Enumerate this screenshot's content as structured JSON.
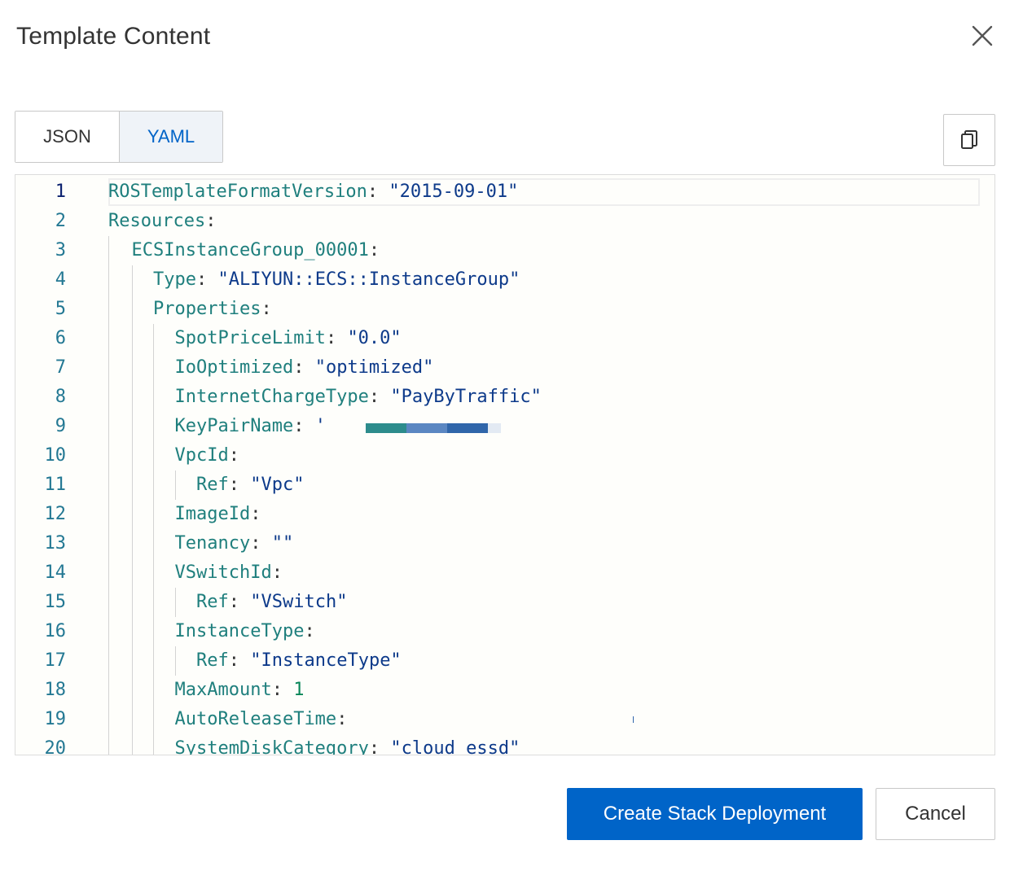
{
  "dialog": {
    "title": "Template Content"
  },
  "tabs": [
    {
      "label": "JSON",
      "active": false
    },
    {
      "label": "YAML",
      "active": true
    }
  ],
  "icons": {
    "close": "close-icon",
    "copy": "copy-icon"
  },
  "editor": {
    "line_numbers": [
      "1",
      "2",
      "3",
      "4",
      "5",
      "6",
      "7",
      "8",
      "9",
      "10",
      "11",
      "12",
      "13",
      "14",
      "15",
      "16",
      "17",
      "18",
      "19",
      "20"
    ],
    "lines": [
      {
        "key": "ROSTemplateFormatVersion",
        "sep": ": ",
        "val": "\"2015-09-01\"",
        "type": "s"
      },
      {
        "key": "Resources",
        "sep": ":",
        "val": "",
        "type": "s"
      },
      {
        "key": "ECSInstanceGroup_00001",
        "sep": ":",
        "val": "",
        "type": "s"
      },
      {
        "key": "Type",
        "sep": ": ",
        "val": "\"ALIYUN::ECS::InstanceGroup\"",
        "type": "s"
      },
      {
        "key": "Properties",
        "sep": ":",
        "val": "",
        "type": "s"
      },
      {
        "key": "SpotPriceLimit",
        "sep": ": ",
        "val": "\"0.0\"",
        "type": "s"
      },
      {
        "key": "IoOptimized",
        "sep": ": ",
        "val": "\"optimized\"",
        "type": "s"
      },
      {
        "key": "InternetChargeType",
        "sep": ": ",
        "val": "\"PayByTraffic\"",
        "type": "s"
      },
      {
        "key": "KeyPairName",
        "sep": ": ",
        "val": "'",
        "type": "s"
      },
      {
        "key": "VpcId",
        "sep": ":",
        "val": "",
        "type": "s"
      },
      {
        "key": "Ref",
        "sep": ": ",
        "val": "\"Vpc\"",
        "type": "s"
      },
      {
        "key": "ImageId",
        "sep": ":",
        "val": "",
        "type": "s"
      },
      {
        "key": "Tenancy",
        "sep": ": ",
        "val": "\"\"",
        "type": "s"
      },
      {
        "key": "VSwitchId",
        "sep": ":",
        "val": "",
        "type": "s"
      },
      {
        "key": "Ref",
        "sep": ": ",
        "val": "\"VSwitch\"",
        "type": "s"
      },
      {
        "key": "InstanceType",
        "sep": ":",
        "val": "",
        "type": "s"
      },
      {
        "key": "Ref",
        "sep": ": ",
        "val": "\"InstanceType\"",
        "type": "s"
      },
      {
        "key": "MaxAmount",
        "sep": ": ",
        "val": "1",
        "type": "n"
      },
      {
        "key": "AutoReleaseTime",
        "sep": ":",
        "val": "",
        "type": "s"
      },
      {
        "key": "SystemDiskCategory",
        "sep": ": ",
        "val": "\"cloud_essd\"",
        "type": "s"
      }
    ]
  },
  "footer": {
    "primary_label": "Create Stack Deployment",
    "cancel_label": "Cancel"
  },
  "colors": {
    "primary": "#0064c8",
    "yaml_key": "#1f7f7d",
    "yaml_string": "#0d3a8a",
    "line_number": "#237893"
  }
}
